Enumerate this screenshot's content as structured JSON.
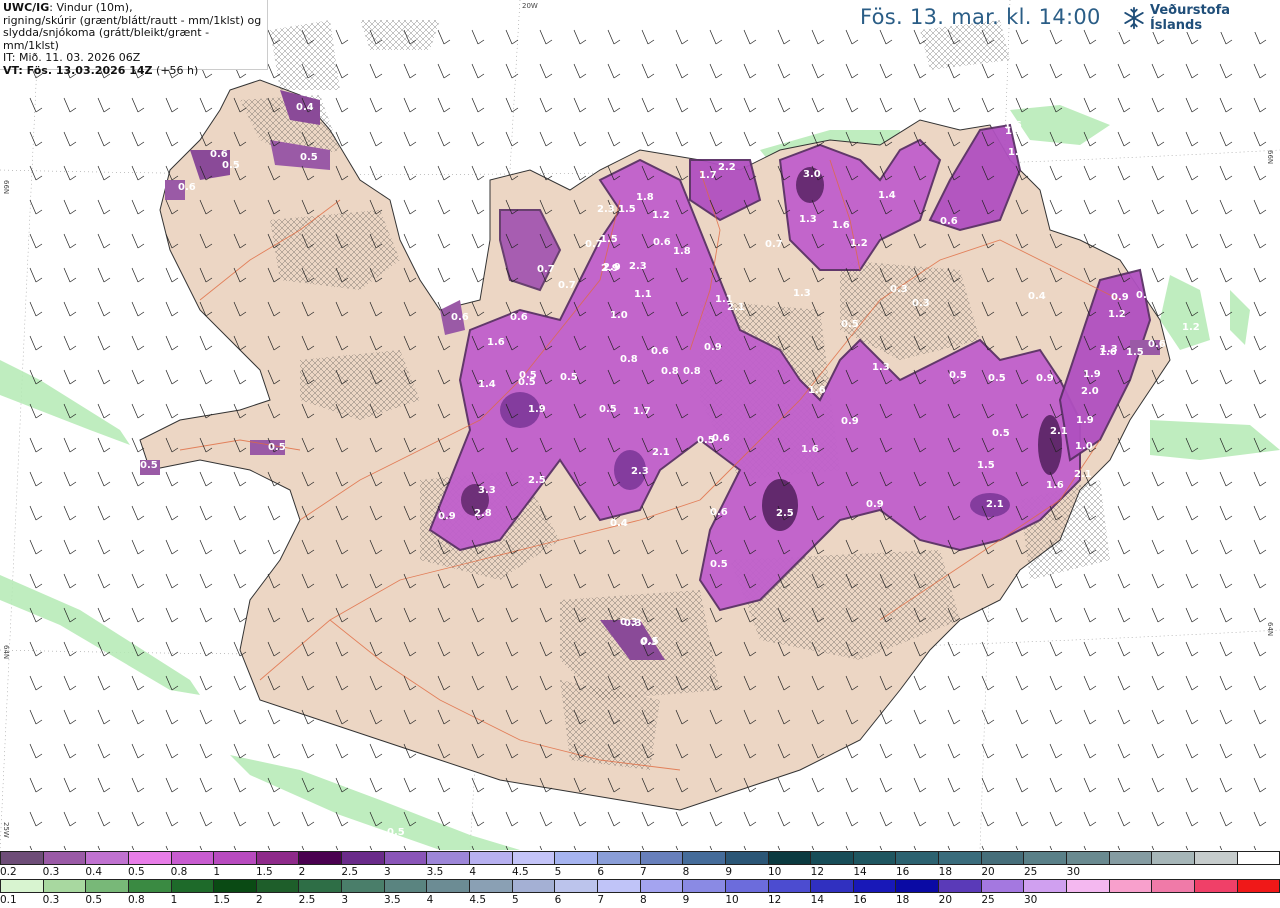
{
  "header": {
    "product": "UWC/IG",
    "desc_line1": ": Vindur (10m),",
    "desc_line2": "rigning/skúrir (grænt/blátt/rautt - mm/1klst) og",
    "desc_line3": "slydda/snjókoma (grátt/bleikt/grænt - mm/1klst)",
    "it_line": "IT: Mið. 11. 03. 2026 06Z",
    "vt_label": "VT: Fös. 13.03.2026 14Z",
    "vt_suffix": " (+56 h)"
  },
  "title": "Fös. 13. mar. kl. 14:00",
  "brand": {
    "name": "Veðurstofa Íslands",
    "icon": "snowflake-logo-icon"
  },
  "grid_labels": {
    "top": "20W",
    "left_upper": "66N",
    "right_upper": "66N",
    "left_lower": "64N",
    "right_lower": "64N",
    "bottom_left": "25W"
  },
  "precip_labels": [
    {
      "t": "0.4"
    },
    {
      "t": "0.5"
    },
    {
      "t": "0.6"
    },
    {
      "t": "0.5"
    },
    {
      "t": "0.6"
    },
    {
      "t": "0.5"
    },
    {
      "t": "0.5"
    },
    {
      "t": "0.7"
    },
    {
      "t": "0.5"
    },
    {
      "t": "1.9"
    },
    {
      "t": "1.4"
    },
    {
      "t": "0.6"
    },
    {
      "t": "1.6"
    },
    {
      "t": "1.0"
    },
    {
      "t": "0.5"
    },
    {
      "t": "2.5"
    },
    {
      "t": "3.3"
    },
    {
      "t": "2.8"
    },
    {
      "t": "1.7"
    },
    {
      "t": "2.3"
    },
    {
      "t": "2.1"
    },
    {
      "t": "0.4"
    },
    {
      "t": "0.5"
    },
    {
      "t": "0.6"
    },
    {
      "t": "2.9"
    },
    {
      "t": "2.3"
    },
    {
      "t": "1.1"
    },
    {
      "t": "2.3"
    },
    {
      "t": "1.5"
    },
    {
      "t": "1.8"
    },
    {
      "t": "1.2"
    },
    {
      "t": "1.8"
    },
    {
      "t": "2.1"
    },
    {
      "t": "3.0"
    },
    {
      "t": "1.3"
    },
    {
      "t": "1.6"
    },
    {
      "t": "1.2"
    },
    {
      "t": "1.4"
    },
    {
      "t": "0.6"
    },
    {
      "t": "1.6"
    },
    {
      "t": "1.3"
    },
    {
      "t": "0.9"
    },
    {
      "t": "2.5"
    },
    {
      "t": "1.6"
    },
    {
      "t": "1.6"
    },
    {
      "t": "0.5"
    },
    {
      "t": "0.9"
    },
    {
      "t": "0.5"
    },
    {
      "t": "1.3"
    },
    {
      "t": "2.1"
    },
    {
      "t": "0.5"
    },
    {
      "t": "0.5"
    },
    {
      "t": "0.9"
    },
    {
      "t": "2.1"
    },
    {
      "t": "1.9"
    },
    {
      "t": "2.0"
    },
    {
      "t": "1.5"
    },
    {
      "t": "2.1"
    },
    {
      "t": "1.6"
    },
    {
      "t": "1.2"
    },
    {
      "t": "0.9"
    },
    {
      "t": "0.4"
    },
    {
      "t": "0.3"
    },
    {
      "t": "0.3"
    },
    {
      "t": "0.5"
    },
    {
      "t": "0.6"
    },
    {
      "t": "0.7"
    },
    {
      "t": "0.8"
    },
    {
      "t": "0.5"
    },
    {
      "t": "0.9"
    },
    {
      "t": "1.2"
    },
    {
      "t": "1.9"
    },
    {
      "t": "1.0"
    },
    {
      "t": "1.3"
    },
    {
      "t": "0.3"
    },
    {
      "t": "0.5"
    },
    {
      "t": "1.6"
    },
    {
      "t": "0.6"
    },
    {
      "t": "0.7"
    },
    {
      "t": "0.5"
    },
    {
      "t": "0.6"
    },
    {
      "t": "2.9"
    },
    {
      "t": "0.6"
    },
    {
      "t": "0.5"
    },
    {
      "t": "0.3"
    },
    {
      "t": "0.3"
    },
    {
      "t": "0.5"
    },
    {
      "t": "0.8"
    },
    {
      "t": "1.2"
    },
    {
      "t": "1.1"
    },
    {
      "t": "0.9"
    },
    {
      "t": "0.8"
    },
    {
      "t": "0.4"
    },
    {
      "t": "1.5"
    },
    {
      "t": "0.6"
    },
    {
      "t": "1.5"
    },
    {
      "t": "2.2"
    },
    {
      "t": "1.7"
    },
    {
      "t": "1.6"
    },
    {
      "t": "0.7"
    }
  ],
  "legend": {
    "snow_colors": [
      "#6e4d78",
      "#9a5aa6",
      "#c072d0",
      "#e87de8",
      "#c85cd0",
      "#b84bbf",
      "#8e2a8a",
      "#4a0050",
      "#6a2b8a",
      "#8a55b8",
      "#9d86d8",
      "#b7b0f0",
      "#c4c4f8",
      "#a6b4f0",
      "#8a9ed8",
      "#6880bc",
      "#456c9a",
      "#2b5676",
      "#0b3a40",
      "#184d58",
      "#1f5660",
      "#2c6270",
      "#3a6c7c",
      "#466e7a",
      "#5a8088",
      "#6a8a90",
      "#859ca2",
      "#a6b6b8",
      "#c6cccc",
      "#ffffff"
    ],
    "snow_labels": [
      "0.2",
      "0.3",
      "0.4",
      "0.5",
      "0.8",
      "1",
      "1.5",
      "2",
      "2.5",
      "3",
      "3.5",
      "4",
      "4.5",
      "5",
      "6",
      "7",
      "8",
      "9",
      "10",
      "12",
      "14",
      "16",
      "18",
      "20",
      "25",
      "30"
    ],
    "rain_colors": [
      "#d8f4d0",
      "#a8d8a0",
      "#78b878",
      "#3a8a42",
      "#1e6a2a",
      "#0a4a14",
      "#1e5e2a",
      "#2e6e46",
      "#4a7e6a",
      "#5a8480",
      "#6c8c94",
      "#8aa0b4",
      "#a4b0d4",
      "#bcc4ec",
      "#c0c4f8",
      "#a4a4f0",
      "#8a8ae4",
      "#6c6cdc",
      "#4c4cd0",
      "#3030c0",
      "#1818b8",
      "#0a0aa4",
      "#5a3ab8",
      "#a478e0",
      "#d0a0f0",
      "#f4b8f0",
      "#f8a0cc",
      "#f07aa8",
      "#f04068",
      "#f01818"
    ],
    "rain_labels": [
      "0.1",
      "0.3",
      "0.5",
      "0.8",
      "1",
      "1.5",
      "2",
      "2.5",
      "3",
      "3.5",
      "4",
      "4.5",
      "5",
      "6",
      "7",
      "8",
      "9",
      "10",
      "12",
      "14",
      "16",
      "18",
      "20",
      "25",
      "30"
    ]
  }
}
